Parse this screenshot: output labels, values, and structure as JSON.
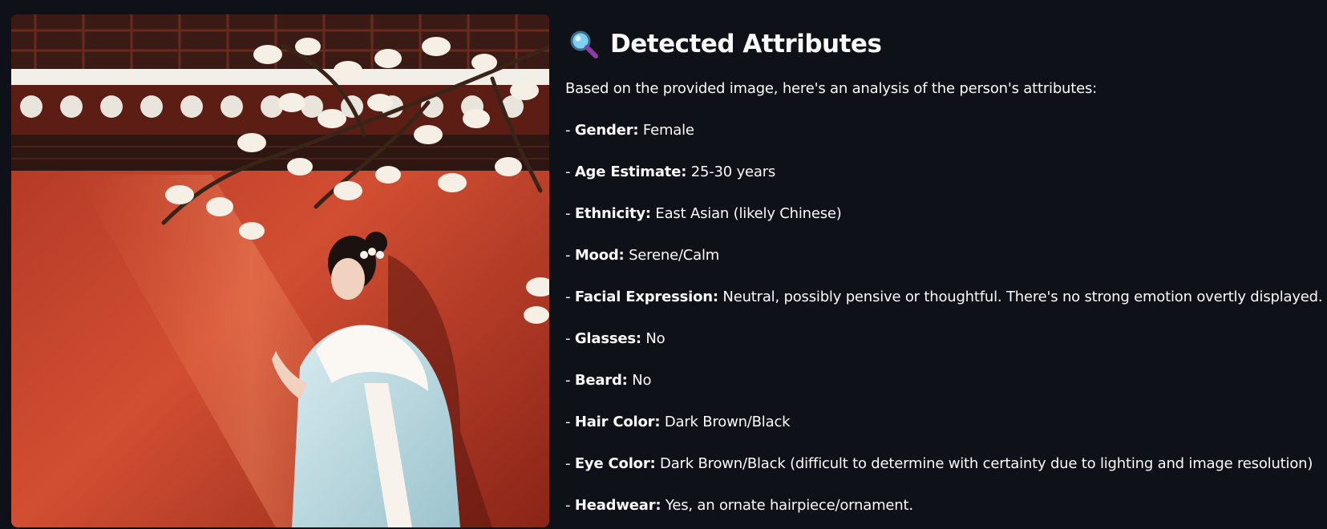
{
  "section": {
    "icon": "magnifying-glass-icon",
    "title": "Detected Attributes",
    "intro": "Based on the provided image, here's an analysis of the person's attributes:"
  },
  "attributes": [
    {
      "prefix": "- ",
      "label": "Gender:",
      "value": " Female"
    },
    {
      "prefix": "- ",
      "label": "Age Estimate:",
      "value": " 25-30 years"
    },
    {
      "prefix": "- ",
      "label": "Ethnicity:",
      "value": " East Asian (likely Chinese)"
    },
    {
      "prefix": "- ",
      "label": "Mood:",
      "value": " Serene/Calm"
    },
    {
      "prefix": "- ",
      "label": "Facial Expression:",
      "value": " Neutral, possibly pensive or thoughtful. There's no strong emotion overtly displayed."
    },
    {
      "prefix": "- ",
      "label": "Glasses:",
      "value": " No"
    },
    {
      "prefix": "- ",
      "label": "Beard:",
      "value": " No"
    },
    {
      "prefix": "- ",
      "label": "Hair Color:",
      "value": " Dark Brown/Black"
    },
    {
      "prefix": "- ",
      "label": "Eye Color:",
      "value": " Dark Brown/Black (difficult to determine with certainty due to lighting and image resolution)"
    },
    {
      "prefix": "- ",
      "label": "Headwear:",
      "value": " Yes, an ornate hairpiece/ornament."
    }
  ],
  "colors": {
    "background": "#0e1117",
    "text": "#fafafa",
    "wall": "#c8442b"
  }
}
